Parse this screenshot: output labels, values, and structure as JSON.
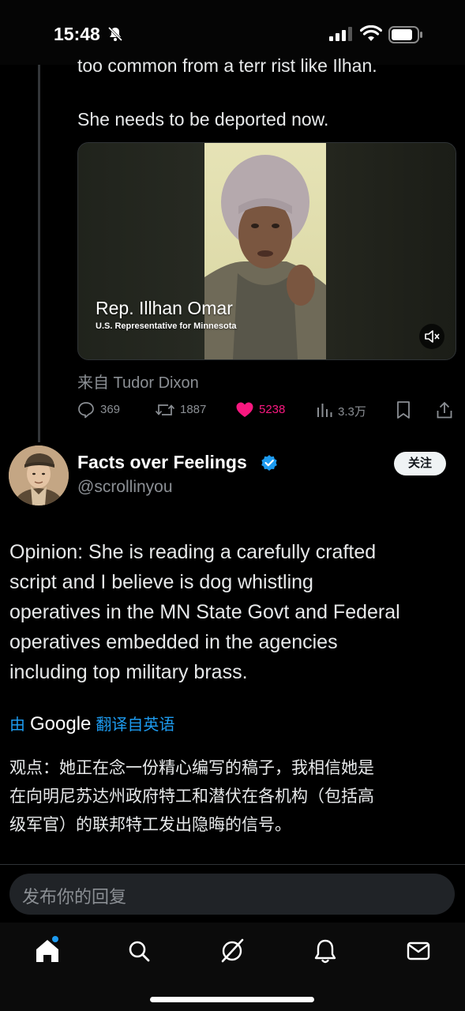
{
  "status_bar": {
    "time": "15:48",
    "icons": [
      "bell-slash-icon",
      "signal-icon",
      "wifi-icon",
      "battery-icon"
    ]
  },
  "parent_tweet": {
    "text_cut": "too common from a terr rist like Ilhan.",
    "text": "She needs to be deported now.",
    "video": {
      "caption_name": "Rep. Illhan Omar",
      "caption_title": "U.S. Representative for Minnesota"
    },
    "source": "来自 Tudor Dixon",
    "actions": {
      "replies": "369",
      "retweets": "1887",
      "likes": "5238",
      "views": "3.3万"
    }
  },
  "reply_tweet": {
    "display_name": "Facts over Feelings",
    "handle": "@scrollinyou",
    "follow_label": "关注",
    "body_lines": [
      "Opinion:  She is reading a carefully crafted",
      "script and I believe is dog whistling",
      "operatives in the MN State Govt and Federal",
      "operatives embedded in the agencies",
      "including top military brass."
    ],
    "translate": {
      "prefix": "由",
      "provider": "Google",
      "suffix": "翻译自英语"
    },
    "translated_lines": [
      "观点：她正在念一份精心编写的稿子，我相信她是",
      "在向明尼苏达州政府特工和潜伏在各机构（包括高",
      "级军官）的联邦特工发出隐晦的信号。"
    ]
  },
  "reply_input": {
    "placeholder": "发布你的回复"
  },
  "tab_bar": {
    "tabs": [
      "home-icon",
      "search-icon",
      "grok-icon",
      "notifications-icon",
      "messages-icon"
    ]
  },
  "colors": {
    "accent": "#1d9bf0",
    "like": "#f91880",
    "muted": "#8b8f94",
    "background": "#000000"
  }
}
